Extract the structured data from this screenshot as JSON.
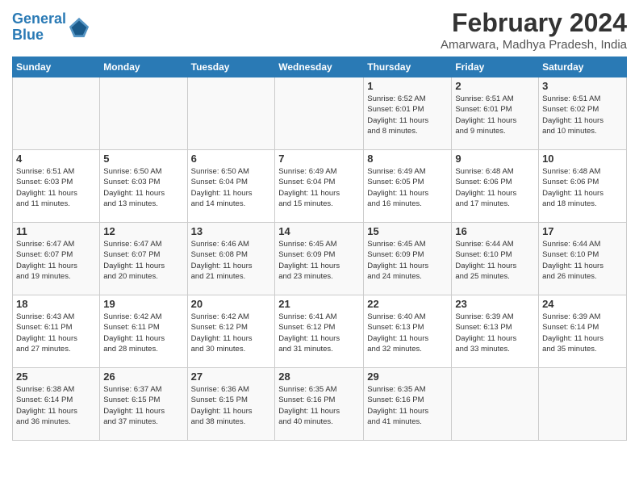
{
  "logo": {
    "line1": "General",
    "line2": "Blue"
  },
  "title": "February 2024",
  "subtitle": "Amarwara, Madhya Pradesh, India",
  "headers": [
    "Sunday",
    "Monday",
    "Tuesday",
    "Wednesday",
    "Thursday",
    "Friday",
    "Saturday"
  ],
  "weeks": [
    [
      {
        "num": "",
        "info": ""
      },
      {
        "num": "",
        "info": ""
      },
      {
        "num": "",
        "info": ""
      },
      {
        "num": "",
        "info": ""
      },
      {
        "num": "1",
        "info": "Sunrise: 6:52 AM\nSunset: 6:01 PM\nDaylight: 11 hours\nand 8 minutes."
      },
      {
        "num": "2",
        "info": "Sunrise: 6:51 AM\nSunset: 6:01 PM\nDaylight: 11 hours\nand 9 minutes."
      },
      {
        "num": "3",
        "info": "Sunrise: 6:51 AM\nSunset: 6:02 PM\nDaylight: 11 hours\nand 10 minutes."
      }
    ],
    [
      {
        "num": "4",
        "info": "Sunrise: 6:51 AM\nSunset: 6:03 PM\nDaylight: 11 hours\nand 11 minutes."
      },
      {
        "num": "5",
        "info": "Sunrise: 6:50 AM\nSunset: 6:03 PM\nDaylight: 11 hours\nand 13 minutes."
      },
      {
        "num": "6",
        "info": "Sunrise: 6:50 AM\nSunset: 6:04 PM\nDaylight: 11 hours\nand 14 minutes."
      },
      {
        "num": "7",
        "info": "Sunrise: 6:49 AM\nSunset: 6:04 PM\nDaylight: 11 hours\nand 15 minutes."
      },
      {
        "num": "8",
        "info": "Sunrise: 6:49 AM\nSunset: 6:05 PM\nDaylight: 11 hours\nand 16 minutes."
      },
      {
        "num": "9",
        "info": "Sunrise: 6:48 AM\nSunset: 6:06 PM\nDaylight: 11 hours\nand 17 minutes."
      },
      {
        "num": "10",
        "info": "Sunrise: 6:48 AM\nSunset: 6:06 PM\nDaylight: 11 hours\nand 18 minutes."
      }
    ],
    [
      {
        "num": "11",
        "info": "Sunrise: 6:47 AM\nSunset: 6:07 PM\nDaylight: 11 hours\nand 19 minutes."
      },
      {
        "num": "12",
        "info": "Sunrise: 6:47 AM\nSunset: 6:07 PM\nDaylight: 11 hours\nand 20 minutes."
      },
      {
        "num": "13",
        "info": "Sunrise: 6:46 AM\nSunset: 6:08 PM\nDaylight: 11 hours\nand 21 minutes."
      },
      {
        "num": "14",
        "info": "Sunrise: 6:45 AM\nSunset: 6:09 PM\nDaylight: 11 hours\nand 23 minutes."
      },
      {
        "num": "15",
        "info": "Sunrise: 6:45 AM\nSunset: 6:09 PM\nDaylight: 11 hours\nand 24 minutes."
      },
      {
        "num": "16",
        "info": "Sunrise: 6:44 AM\nSunset: 6:10 PM\nDaylight: 11 hours\nand 25 minutes."
      },
      {
        "num": "17",
        "info": "Sunrise: 6:44 AM\nSunset: 6:10 PM\nDaylight: 11 hours\nand 26 minutes."
      }
    ],
    [
      {
        "num": "18",
        "info": "Sunrise: 6:43 AM\nSunset: 6:11 PM\nDaylight: 11 hours\nand 27 minutes."
      },
      {
        "num": "19",
        "info": "Sunrise: 6:42 AM\nSunset: 6:11 PM\nDaylight: 11 hours\nand 28 minutes."
      },
      {
        "num": "20",
        "info": "Sunrise: 6:42 AM\nSunset: 6:12 PM\nDaylight: 11 hours\nand 30 minutes."
      },
      {
        "num": "21",
        "info": "Sunrise: 6:41 AM\nSunset: 6:12 PM\nDaylight: 11 hours\nand 31 minutes."
      },
      {
        "num": "22",
        "info": "Sunrise: 6:40 AM\nSunset: 6:13 PM\nDaylight: 11 hours\nand 32 minutes."
      },
      {
        "num": "23",
        "info": "Sunrise: 6:39 AM\nSunset: 6:13 PM\nDaylight: 11 hours\nand 33 minutes."
      },
      {
        "num": "24",
        "info": "Sunrise: 6:39 AM\nSunset: 6:14 PM\nDaylight: 11 hours\nand 35 minutes."
      }
    ],
    [
      {
        "num": "25",
        "info": "Sunrise: 6:38 AM\nSunset: 6:14 PM\nDaylight: 11 hours\nand 36 minutes."
      },
      {
        "num": "26",
        "info": "Sunrise: 6:37 AM\nSunset: 6:15 PM\nDaylight: 11 hours\nand 37 minutes."
      },
      {
        "num": "27",
        "info": "Sunrise: 6:36 AM\nSunset: 6:15 PM\nDaylight: 11 hours\nand 38 minutes."
      },
      {
        "num": "28",
        "info": "Sunrise: 6:35 AM\nSunset: 6:16 PM\nDaylight: 11 hours\nand 40 minutes."
      },
      {
        "num": "29",
        "info": "Sunrise: 6:35 AM\nSunset: 6:16 PM\nDaylight: 11 hours\nand 41 minutes."
      },
      {
        "num": "",
        "info": ""
      },
      {
        "num": "",
        "info": ""
      }
    ]
  ]
}
